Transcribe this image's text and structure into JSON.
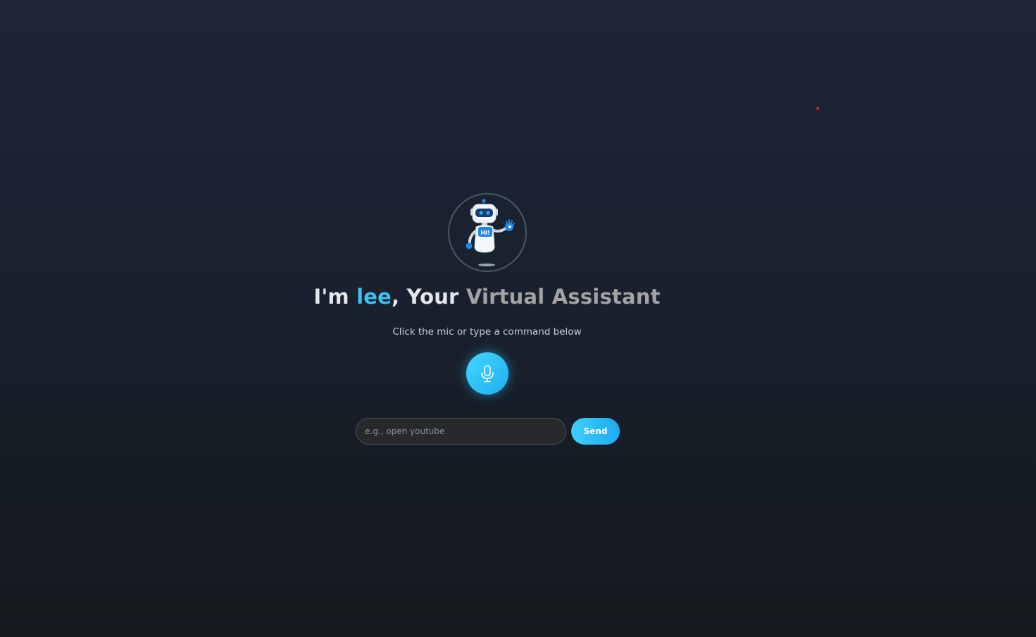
{
  "header": {
    "title_prefix": "I'm ",
    "assistant_name": "lee",
    "title_middle": ", Your ",
    "title_role": "Virtual Assistant"
  },
  "subtitle": "Click the mic or type a command below",
  "avatar": {
    "icon": "robot-waving-icon",
    "badge_text": "HI!"
  },
  "mic": {
    "icon": "microphone-icon"
  },
  "command": {
    "placeholder": "e.g., open youtube",
    "value": "",
    "send_label": "Send"
  },
  "colors": {
    "accent": "#3cc3f5",
    "indicator": "#d3262b"
  }
}
